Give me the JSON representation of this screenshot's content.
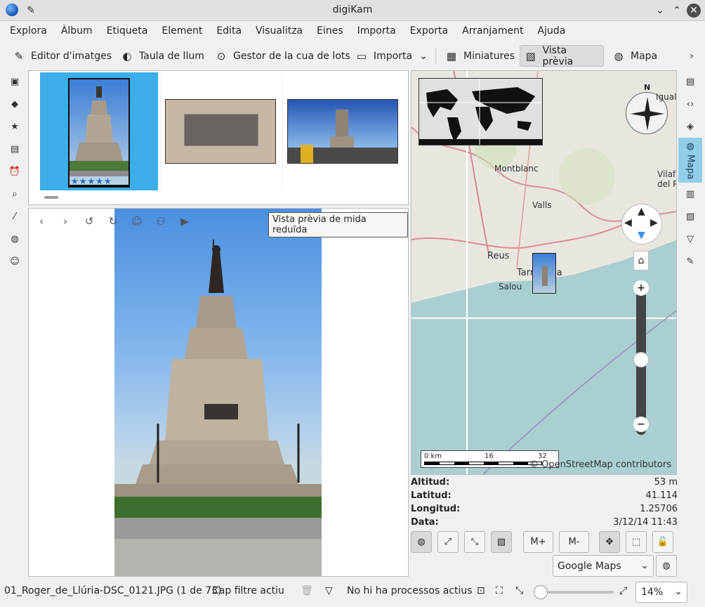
{
  "window": {
    "title": "digiKam"
  },
  "menu": [
    "Explora",
    "Àlbum",
    "Etiqueta",
    "Element",
    "Edita",
    "Visualitza",
    "Eines",
    "Importa",
    "Exporta",
    "Arranjament",
    "Ajuda"
  ],
  "toolbar": {
    "image_editor": "Editor d'imatges",
    "light_table": "Taula de llum",
    "batch_queue": "Gestor de la cua de lots",
    "import": "Importa",
    "thumbnails": "Miniatures",
    "preview": "Vista prèvia",
    "map": "Mapa"
  },
  "right_sidebar": {
    "map_tab": "Mapa"
  },
  "preview": {
    "tooltip": "Vista prèvia de mida reduïda"
  },
  "thumbnails": [
    {
      "label": "Roger de Llúria statue",
      "selected": true,
      "rating": 5,
      "rating_max": 5
    },
    {
      "label": "plaque",
      "selected": false
    },
    {
      "label": "statue at promenade",
      "selected": false
    }
  ],
  "map": {
    "labels": {
      "montblanc": "Montblanc",
      "valls": "Valls",
      "reus": "Reus",
      "tarragona": "Tarragona",
      "salou": "Salou",
      "ignalada": "Igualada",
      "vilafranca": "Vilafranca del Pe",
      "attribution": "© OpenStreetMap contributors"
    },
    "scale": {
      "zero": "0 km",
      "mid": "16",
      "end": "32"
    },
    "compass_n": "N",
    "zoom_in": "+",
    "zoom_out": "−"
  },
  "info": {
    "altitude_label": "Altitud:",
    "altitude": "53 m",
    "latitude_label": "Latitud:",
    "latitude": "41.114",
    "longitude_label": "Longitud:",
    "longitude": "1.25706",
    "date_label": "Data:",
    "date": "3/12/14 11:43"
  },
  "map_buttons": {
    "mplus": "M+",
    "mminus": "M-"
  },
  "map_provider": "Google Maps",
  "status": {
    "file": "01_Roger_de_Llúria-DSC_0121.JPG (1 de 73)",
    "filter": "Cap filtre actiu",
    "processes": "No hi ha processos actius",
    "zoom": "14%"
  },
  "colors": {
    "accent": "#3daee9",
    "map_tab": "#93cee9"
  }
}
